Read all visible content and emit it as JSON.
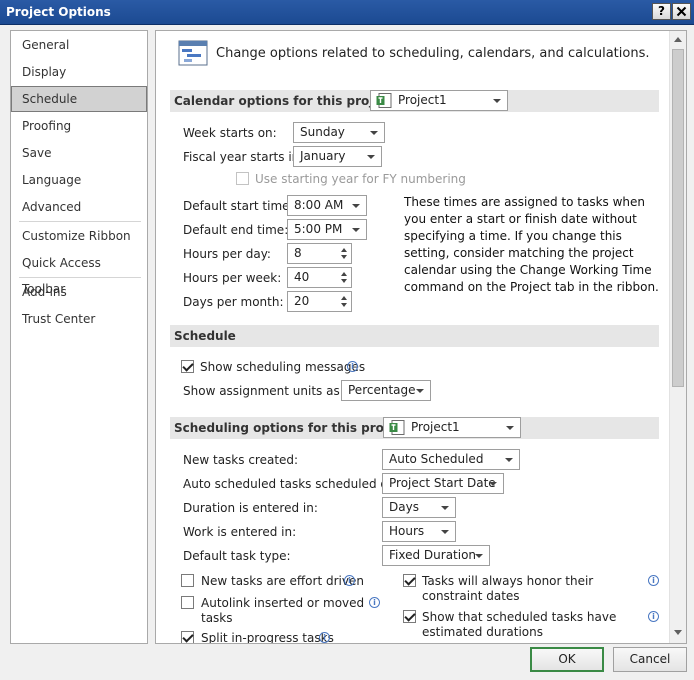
{
  "window": {
    "title": "Project Options",
    "help_label": "?",
    "close_label": "X"
  },
  "sidebar": {
    "items": [
      {
        "label": "General"
      },
      {
        "label": "Display"
      },
      {
        "label": "Schedule",
        "selected": true
      },
      {
        "label": "Proofing"
      },
      {
        "label": "Save"
      },
      {
        "label": "Language"
      },
      {
        "label": "Advanced"
      },
      {
        "label": "Customize Ribbon"
      },
      {
        "label": "Quick Access Toolbar"
      },
      {
        "label": "Add-ins"
      },
      {
        "label": "Trust Center"
      }
    ]
  },
  "header": {
    "text": "Change options related to scheduling, calendars, and calculations."
  },
  "calendar_section": {
    "title": "Calendar options for this project:",
    "project_value": "Project1",
    "week_starts_label": "Week starts on:",
    "week_starts_value": "Sunday",
    "fiscal_year_label": "Fiscal year starts in:",
    "fiscal_year_value": "January",
    "fy_numbering_label": "Use starting year for FY numbering",
    "fy_numbering_checked": false,
    "default_start_label": "Default start time:",
    "default_start_value": "8:00 AM",
    "default_end_label": "Default end time:",
    "default_end_value": "5:00 PM",
    "hours_per_day_label": "Hours per day:",
    "hours_per_day_value": "8",
    "hours_per_week_label": "Hours per week:",
    "hours_per_week_value": "40",
    "days_per_month_label": "Days per month:",
    "days_per_month_value": "20",
    "note": "These times are assigned to tasks when you enter a start or finish date without specifying a time. If you change this setting, consider matching the project calendar using the Change Working Time command on the Project tab in the ribbon."
  },
  "schedule_section": {
    "title": "Schedule",
    "show_messages_label": "Show scheduling messages",
    "show_messages_checked": true,
    "assignment_units_label": "Show assignment units as a:",
    "assignment_units_value": "Percentage"
  },
  "scheduling_options": {
    "title": "Scheduling options for this project:",
    "project_value": "Project1",
    "new_tasks_label": "New tasks created:",
    "new_tasks_value": "Auto Scheduled",
    "auto_sched_label": "Auto scheduled tasks scheduled on:",
    "auto_sched_value": "Project Start Date",
    "duration_label": "Duration is entered in:",
    "duration_value": "Days",
    "work_label": "Work is entered in:",
    "work_value": "Hours",
    "task_type_label": "Default task type:",
    "task_type_value": "Fixed Duration",
    "effort_driven_label": "New tasks are effort driven",
    "effort_driven_checked": false,
    "autolink_label": "Autolink inserted or moved tasks",
    "autolink_checked": false,
    "split_label": "Split in-progress tasks",
    "split_checked": true,
    "honor_constraints_label": "Tasks will always honor their constraint dates",
    "honor_constraints_checked": true,
    "estimated_durations_label": "Show that scheduled tasks have estimated durations",
    "estimated_durations_checked": true
  },
  "buttons": {
    "ok": "OK",
    "cancel": "Cancel"
  },
  "colors": {
    "titlebar": "#1c4a92",
    "selected_nav": "#d2d2d2",
    "section_band": "#e6e6e6",
    "ok_border": "#3a8a45"
  }
}
